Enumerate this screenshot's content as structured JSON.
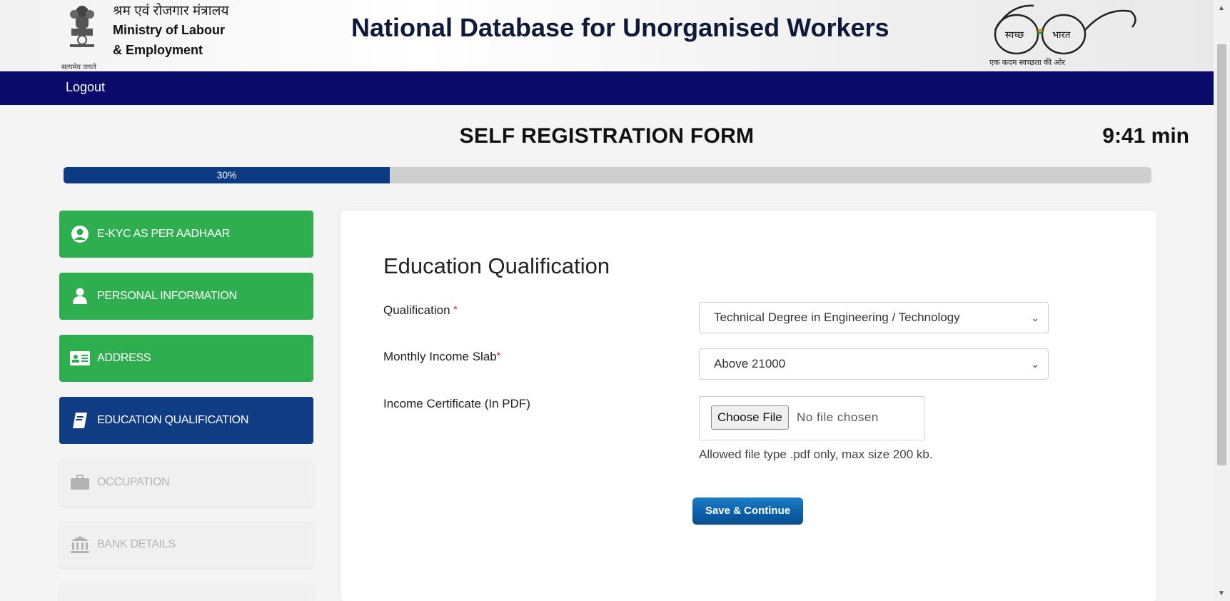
{
  "header": {
    "ministry_hindi": "श्रम एवं रोजगार मंत्रालय",
    "ministry_line1": "Ministry of Labour",
    "ministry_line2": "& Employment",
    "emblem_motto": "सत्यमेव जयते",
    "site_title": "National Database for Unorganised Workers",
    "swachh_left": "स्वच्छ",
    "swachh_right": "भारत",
    "swachh_tagline": "एक कदम स्वच्छता की ओर"
  },
  "nav": {
    "logout": "Logout"
  },
  "form": {
    "title": "SELF REGISTRATION FORM",
    "timer": "9:41 min",
    "progress_label": "30%",
    "progress_value": 0.3
  },
  "sidebar": {
    "items": [
      {
        "label": "E-KYC AS PER AADHAAR",
        "state": "done",
        "icon": "user-circle-icon"
      },
      {
        "label": "PERSONAL INFORMATION",
        "state": "done",
        "icon": "person-icon"
      },
      {
        "label": "ADDRESS",
        "state": "done",
        "icon": "id-card-icon"
      },
      {
        "label": "EDUCATION QUALIFICATION",
        "state": "active",
        "icon": "book-icon"
      },
      {
        "label": "OCCUPATION",
        "state": "pending",
        "icon": "briefcase-icon"
      },
      {
        "label": "BANK DETAILS",
        "state": "pending",
        "icon": "bank-icon"
      }
    ]
  },
  "main": {
    "section_title": "Education Qualification",
    "qualification_label": "Qualification",
    "qualification_value": "Technical Degree in Engineering / Technology",
    "income_label": "Monthly Income Slab",
    "income_value": "Above 21000",
    "certificate_label": "Income Certificate (In PDF)",
    "choose_file": "Choose File",
    "no_file": "No file chosen",
    "hint": "Allowed file type .pdf only, max size 200 kb.",
    "save_button": "Save & Continue",
    "required_mark": "*"
  },
  "colors": {
    "navbar": "#0a0a6b",
    "done": "#2fae4f",
    "active": "#0f3c82",
    "progress_fill": "#0c3a83",
    "save_button": "#0b5ea6"
  }
}
